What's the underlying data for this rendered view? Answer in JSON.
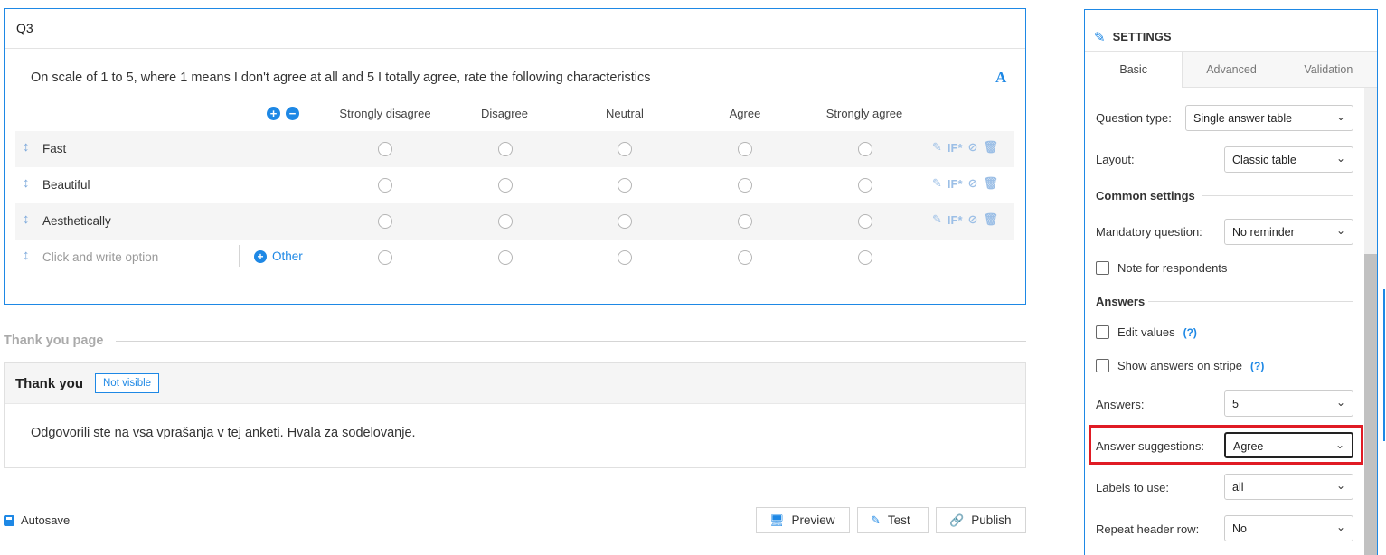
{
  "question": {
    "number": "Q3",
    "text": "On scale of 1 to 5, where 1 means I don't agree at all and 5 I totally agree, rate the following characteristics",
    "font_icon": "A",
    "columns": [
      "Strongly disagree",
      "Disagree",
      "Neutral",
      "Agree",
      "Strongly agree"
    ],
    "rows": [
      {
        "label": "Fast"
      },
      {
        "label": "Beautiful"
      },
      {
        "label": "Aesthetically"
      }
    ],
    "new_option_placeholder": "Click and write option",
    "other_label": "Other",
    "if_label": "IF*"
  },
  "thank_you": {
    "section_title": "Thank you page",
    "title": "Thank you",
    "badge": "Not visible",
    "text": "Odgovorili ste na vsa vprašanja v tej anketi. Hvala za sodelovanje."
  },
  "footer": {
    "autosave": "Autosave",
    "preview": "Preview",
    "test": "Test",
    "publish": "Publish"
  },
  "settings": {
    "title": "SETTINGS",
    "tabs": [
      "Basic",
      "Advanced",
      "Validation"
    ],
    "question_type_label": "Question type:",
    "question_type_value": "Single answer table",
    "layout_label": "Layout:",
    "layout_value": "Classic table",
    "common_settings": "Common settings",
    "mandatory_label": "Mandatory question:",
    "mandatory_value": "No reminder",
    "note_label": "Note for respondents",
    "answers_group": "Answers",
    "edit_values_label": "Edit values",
    "show_stripe_label": "Show answers on stripe",
    "help": "(?)",
    "answers_label": "Answers:",
    "answers_value": "5",
    "suggestions_label": "Answer suggestions:",
    "suggestions_value": "Agree",
    "labels_label": "Labels to use:",
    "labels_value": "all",
    "repeat_label": "Repeat header row:",
    "repeat_value": "No"
  },
  "colors": {
    "accent": "#1e88e5",
    "highlight": "#e01b24"
  }
}
